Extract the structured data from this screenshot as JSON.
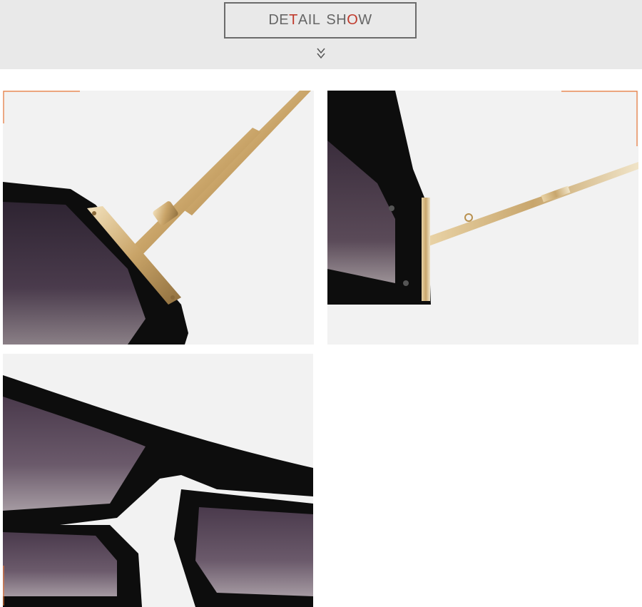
{
  "header": {
    "title_parts": {
      "p1": "DE",
      "p2": "T",
      "p3": "AIL",
      "p4": "SH",
      "p5": "O",
      "p6": "W"
    },
    "accent_color": "#c0392b",
    "arrow_icon": "double-chevron-down-icon"
  },
  "photos": [
    {
      "name": "hinge-detail-photo"
    },
    {
      "name": "temple-side-detail-photo"
    },
    {
      "name": "nose-bridge-detail-photo"
    }
  ],
  "colors": {
    "frame": "#0d0d0d",
    "gold": "#d4b27a",
    "lens": "#3e3140",
    "corner_mark": "#e8773a"
  }
}
